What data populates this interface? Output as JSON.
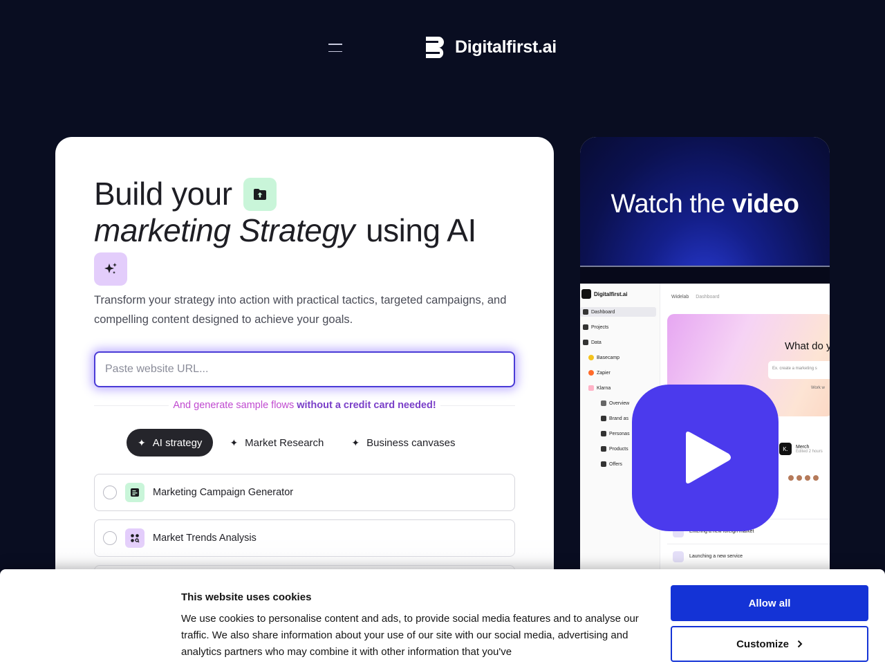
{
  "header": {
    "brand": "Digitalfirst.ai",
    "menu_icon": "hamburger-menu-icon"
  },
  "hero": {
    "title_part1": "Build your",
    "title_italic": "marketing Strategy",
    "title_part2": "using AI",
    "subtitle": "Transform your strategy into action with practical tactics, targeted campaigns, and compelling content designed to achieve your goals.",
    "url_placeholder": "Paste website URL...",
    "note_plain": "And generate sample flows",
    "note_bold": "without a credit card needed!",
    "icons": {
      "folder": "folder-upload-icon",
      "sparkle": "sparkle-icon"
    },
    "colors": {
      "input_border": "#4a3bd6",
      "note_pink": "#c04ad0",
      "note_purple": "#7a3fc8"
    }
  },
  "tabs": [
    {
      "label": "AI strategy",
      "active": true
    },
    {
      "label": "Market Research",
      "active": false
    },
    {
      "label": "Business canvases",
      "active": false
    }
  ],
  "options": [
    {
      "label": "Marketing Campaign Generator",
      "icon": "campaign-icon",
      "icon_bg": "#c9f5d9"
    },
    {
      "label": "Market Trends Analysis",
      "icon": "trends-icon",
      "icon_bg": "#e3cdfb"
    }
  ],
  "video": {
    "watch_plain": "Watch the",
    "watch_bold": "video",
    "play_color": "#4b3aed",
    "app": {
      "brand": "Digitalfirst.ai",
      "crumb_1": "Widelab",
      "crumb_2": "Dashboard",
      "sidebar": [
        "Dashboard",
        "Projects",
        "Data",
        "Basecamp",
        "Zapier",
        "Klarna",
        "Overview",
        "Brand as",
        "Personas",
        "Products",
        "Offers"
      ],
      "banner_question": "What do y",
      "banner_input": "Ex. create a marketing s",
      "banner_small": "Work w",
      "merch_title": "Merch",
      "merch_sub": "Edited 2 hours",
      "merch_mark": "K.",
      "rows": [
        "Entering a new foreign market",
        "Launching a new service"
      ]
    }
  },
  "cookie": {
    "title": "This website uses cookies",
    "body": "We use cookies to personalise content and ads, to provide social media features and to analyse our traffic. We also share information about your use of our site with our social media, advertising and analytics partners who may combine it with other information that you've",
    "allow_label": "Allow all",
    "customize_label": "Customize",
    "accent": "#1433d6"
  }
}
